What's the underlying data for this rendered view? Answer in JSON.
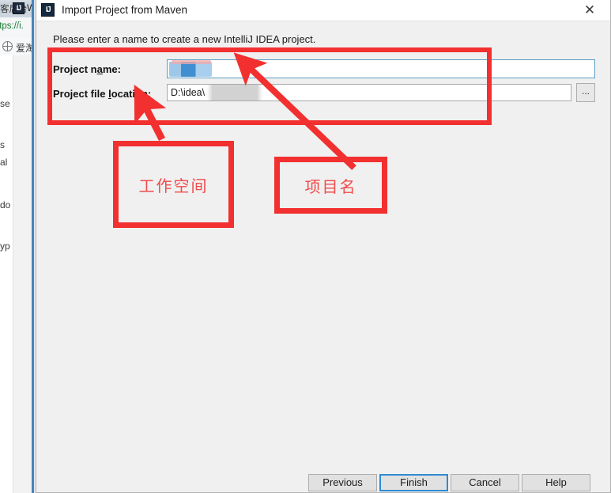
{
  "background_window": {
    "tab_label": "客后台",
    "url": "ttps://i.",
    "bookmark_label": "爱淘",
    "app_icon_label": "IJ",
    "app_name": "W",
    "page_fragments": [
      "se",
      "s",
      "al",
      "do",
      "yp"
    ],
    "close_icon": "close-icon",
    "close_glyph": "✕"
  },
  "dialog": {
    "icon_label": "IJ",
    "title": "Import Project from Maven",
    "close_glyph": "✕",
    "instruction": "Please enter a name to create a new IntelliJ IDEA project.",
    "fields": {
      "project_name": {
        "label_pre": "Project n",
        "label_mnemonic": "a",
        "label_post": "me:",
        "value": "",
        "redacted": true
      },
      "project_file_location": {
        "label_pre": "Project file ",
        "label_mnemonic": "l",
        "label_post": "ocation:",
        "value": "D:\\idea\\",
        "redacted": true,
        "browse_label": "..."
      }
    },
    "buttons": {
      "previous": "Previous",
      "finish": "Finish",
      "cancel": "Cancel",
      "help": "Help"
    }
  },
  "annotations": {
    "workspace_box": "工作空间",
    "projectname_box": "项目名",
    "highlight_color": "#f23030",
    "text_color": "#f04b4b"
  }
}
